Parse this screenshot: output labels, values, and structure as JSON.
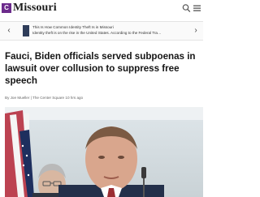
{
  "header": {
    "logo_letter": "C",
    "brand": "Missouri"
  },
  "ticker": {
    "line1": "This Is How Common Identity Theft Is in Missouri",
    "line2": "Identity theft is on the rise in the United States. According to the Federal Tra…"
  },
  "article": {
    "headline": "Fauci, Biden officials served subpoenas in lawsuit over collusion to suppress free speech",
    "byline": "By Joe Mueller | The Center Square",
    "time": "10 hrs ago"
  },
  "colors": {
    "brand_purple": "#6c2b8c"
  }
}
